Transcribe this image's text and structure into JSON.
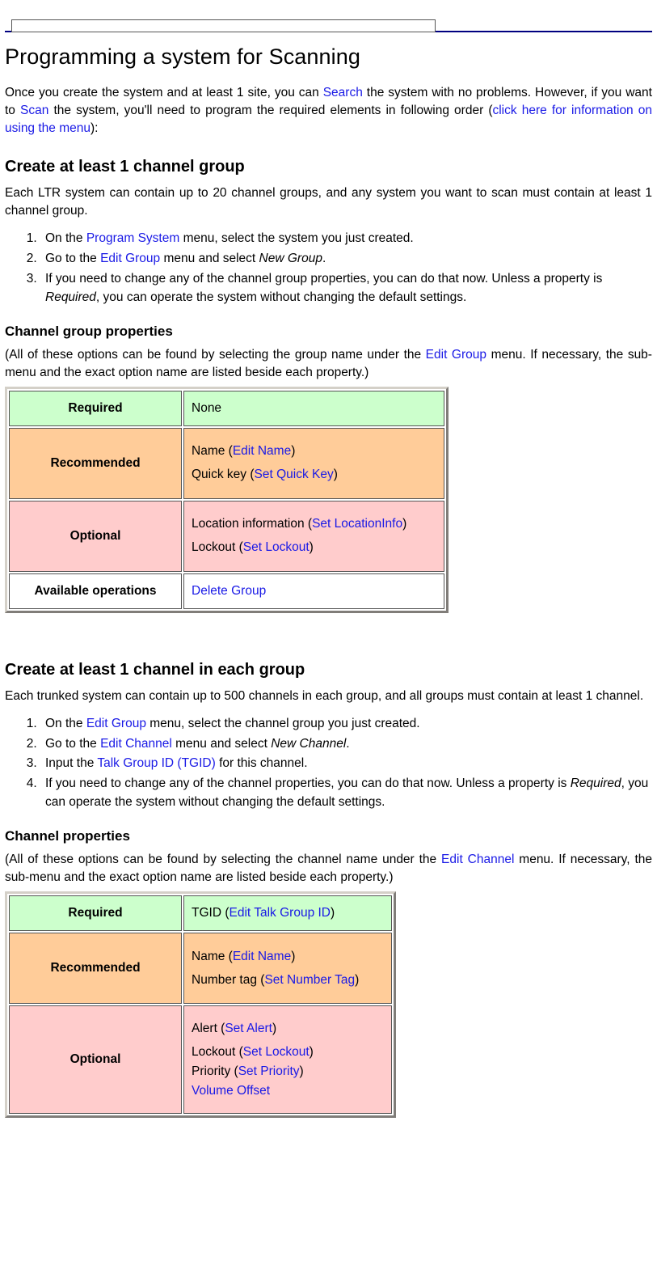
{
  "document": {
    "title": "Programming a system for Scanning",
    "intro": {
      "seg1": "Once you create the system and at least 1 site, you can ",
      "link_search": "Search",
      "seg2": " the system with no problems. However, if you want to ",
      "link_scan": "Scan",
      "seg3": " the system, you'll need to program the required elements in following order (",
      "link_menu_info": "click here for information on using the menu",
      "seg4": "):"
    }
  },
  "section_group": {
    "heading": "Create at least 1 channel group",
    "intro": "Each LTR system can contain up to 20 channel groups, and any system you want to scan must contain at least 1 channel group.",
    "steps": [
      {
        "seg1": "On the ",
        "link": "Program System",
        "seg2": " menu, select the system you just created."
      },
      {
        "seg1": "Go to the ",
        "link": "Edit Group",
        "seg2": " menu and select ",
        "italic": "New Group",
        "seg3": "."
      },
      {
        "seg1": "If you need to change any of the channel group properties, you can do that now. Unless a property is ",
        "italic": "Required",
        "seg2": ", you can operate the system without changing the default settings."
      }
    ],
    "properties_heading": "Channel group properties",
    "properties_note": {
      "seg1": "(All of these options can be found by selecting the group name under the ",
      "link": "Edit Group",
      "seg2": " menu. If necessary, the sub-menu and the exact option name are listed beside each property.)"
    },
    "table": {
      "rows": [
        {
          "label": "Required",
          "color": "#ccffcc",
          "values": [
            {
              "text": "None",
              "link": ""
            }
          ]
        },
        {
          "label": "Recommended",
          "color": "#ffcc99",
          "values": [
            {
              "text": "Name (",
              "link": "Edit Name",
              "after": ")"
            },
            {
              "text": "Quick key (",
              "link": "Set Quick Key",
              "after": ")"
            }
          ]
        },
        {
          "label": "Optional",
          "color": "#ffcccc",
          "values": [
            {
              "text": "Location information (",
              "link": "Set LocationInfo",
              "after": ")"
            },
            {
              "text": "Lockout (",
              "link": "Set Lockout",
              "after": ")"
            }
          ]
        },
        {
          "label": "Available operations",
          "color": "#ffffff",
          "values": [
            {
              "text": "",
              "link": "Delete Group",
              "after": ""
            }
          ]
        }
      ]
    }
  },
  "section_channel": {
    "heading": "Create at least 1 channel in each group",
    "intro": "Each trunked system can contain up to 500 channels in each group, and all groups must contain at least 1 channel.",
    "steps": [
      {
        "seg1": "On the ",
        "link": "Edit Group",
        "seg2": " menu, select the channel group you just created."
      },
      {
        "seg1": "Go to the ",
        "link": "Edit Channel",
        "seg2": " menu and select ",
        "italic": "New Channel",
        "seg3": "."
      },
      {
        "seg1": "Input the ",
        "link": "Talk Group ID (TGID)",
        "seg2": " for this channel."
      },
      {
        "seg1": "If you need to change any of the channel properties, you can do that now. Unless a property is ",
        "italic": "Required",
        "seg2": ", you can operate the system without changing the default settings."
      }
    ],
    "properties_heading": "Channel properties",
    "properties_note": {
      "seg1": "(All of these options can be found by selecting the channel name under the ",
      "link": "Edit Channel",
      "seg2": " menu. If necessary, the sub-menu and the exact option name are listed beside each property.)"
    },
    "table": {
      "rows": [
        {
          "label": "Required",
          "color": "#ccffcc",
          "values": [
            {
              "text": "TGID (",
              "link": "Edit Talk Group ID",
              "after": ")"
            }
          ]
        },
        {
          "label": "Recommended",
          "color": "#ffcc99",
          "values": [
            {
              "text": "Name (",
              "link": "Edit Name",
              "after": ")"
            },
            {
              "text": "Number tag (",
              "link": "Set Number Tag",
              "after": ")"
            }
          ]
        },
        {
          "label": "Optional",
          "color": "#ffcccc",
          "values": [
            {
              "text": "Alert (",
              "link": "Set Alert",
              "after": ")"
            },
            {
              "text": "Lockout (",
              "link": "Set Lockout",
              "after": ")"
            },
            {
              "text": "Priority (",
              "link": "Set Priority",
              "after": ")"
            },
            {
              "text": "",
              "link": "Volume Offset",
              "after": ""
            }
          ]
        }
      ]
    }
  },
  "colors": {
    "link": "#1a1ae6",
    "rule": "#000080",
    "required_bg": "#ccffcc",
    "recommended_bg": "#ffcc99",
    "optional_bg": "#ffcccc",
    "available_bg": "#ffffff"
  }
}
